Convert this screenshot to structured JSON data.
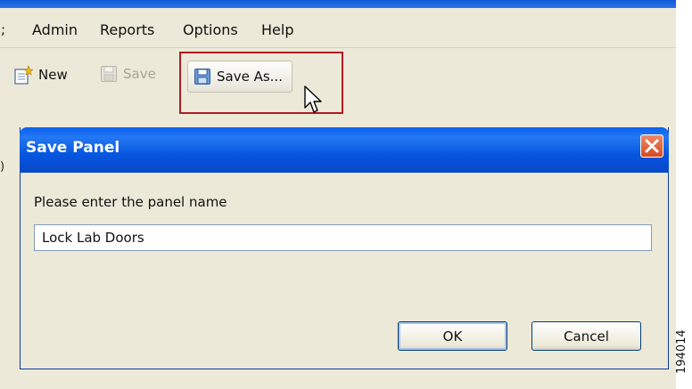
{
  "menubar": {
    "fragment": ";",
    "items": [
      {
        "label": "Admin"
      },
      {
        "label": "Reports"
      },
      {
        "label": "Options"
      },
      {
        "label": "Help"
      }
    ]
  },
  "toolbar": {
    "new_label": "New",
    "save_label": "Save",
    "save_as_label": "Save As..."
  },
  "left_fragment": ")",
  "dialog": {
    "title": "Save Panel",
    "prompt": "Please enter the panel name",
    "input_value": "Lock Lab Doors",
    "ok_label": "OK",
    "cancel_label": "Cancel"
  },
  "figure_id": "194014",
  "colors": {
    "titlebar": "#0656e0",
    "highlight": "#b01c22",
    "close_button": "#d24a22",
    "window_bg": "#ece9d8"
  }
}
